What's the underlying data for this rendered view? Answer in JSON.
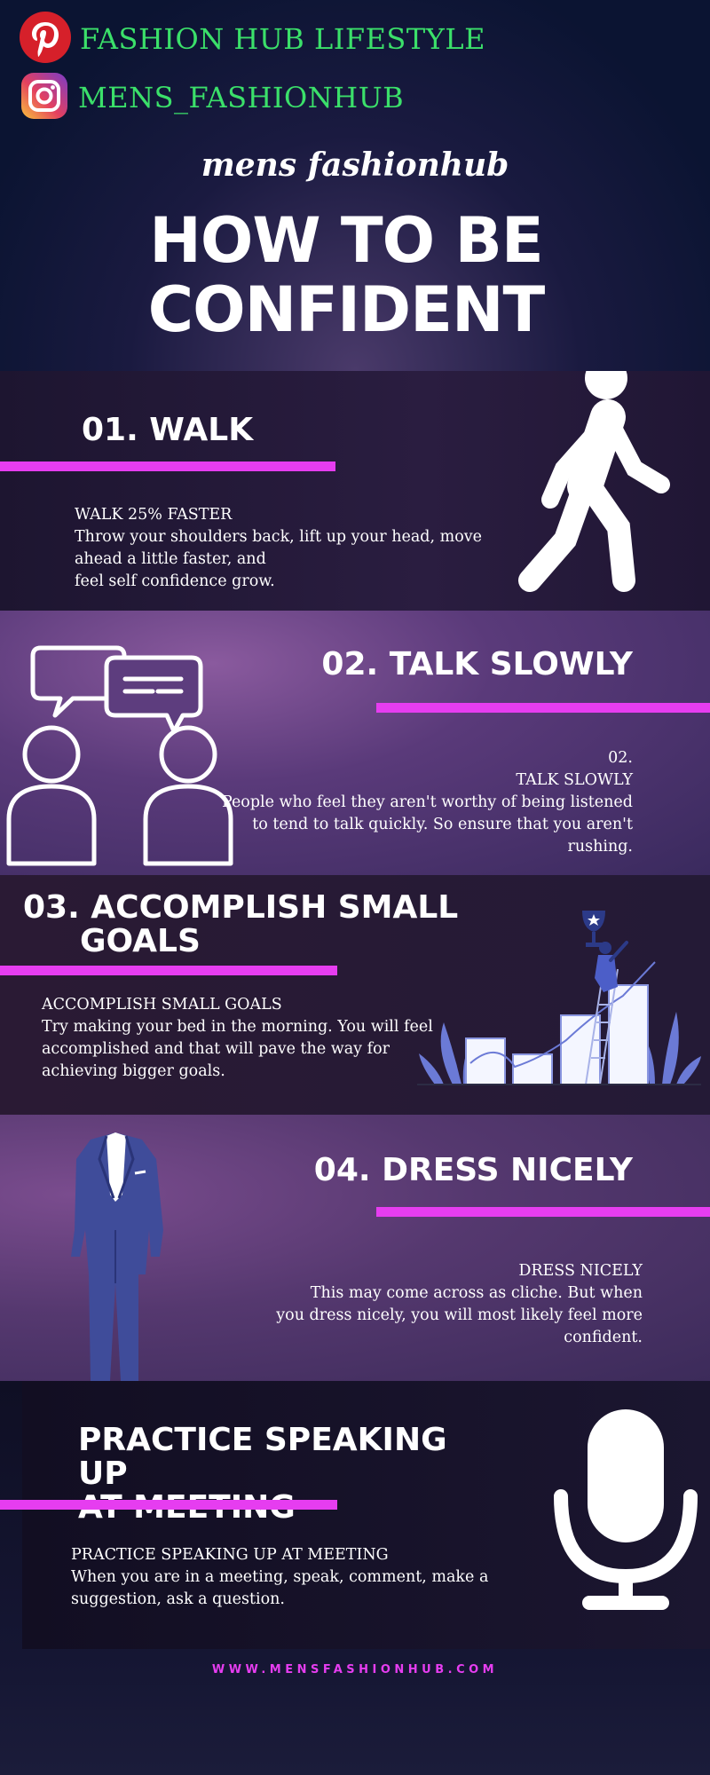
{
  "social": {
    "pinterest_label": "FASHION HUB LIFESTYLE",
    "instagram_label": "MENS_FASHIONHUB"
  },
  "brand": "mens fashionhub",
  "title": {
    "line1": "HOW TO BE",
    "line2": "CONFIDENT"
  },
  "sections": [
    {
      "heading": "01.  WALK",
      "subheading": "WALK 25% FASTER",
      "body": [
        "Throw your shoulders back, lift up your head, move",
        "ahead a little faster, and",
        "feel self confidence grow."
      ]
    },
    {
      "heading": "02. TALK SLOWLY",
      "label": "02.",
      "subheading": "TALK SLOWLY",
      "body": [
        "People who feel they aren't worthy of being listened",
        "to tend to talk quickly. So ensure that you aren't",
        "rushing."
      ]
    },
    {
      "heading_line1": "03. ACCOMPLISH SMALL",
      "heading_line2": "GOALS",
      "subheading": "ACCOMPLISH SMALL GOALS",
      "body": [
        "Try making your bed in the morning. You will feel",
        "accomplished and that will pave the way for",
        "achieving bigger goals."
      ]
    },
    {
      "heading": "04. DRESS NICELY",
      "subheading": "DRESS NICELY",
      "body": [
        "This may come across as cliche. But when",
        "you dress nicely, you will most likely feel more",
        "confident."
      ]
    },
    {
      "heading_line1": "PRACTICE SPEAKING UP",
      "heading_line2": "AT MEETING",
      "subheading": "PRACTICE SPEAKING UP AT MEETING",
      "body": [
        "When you are in a meeting, speak, comment, make a",
        "suggestion, ask a question."
      ]
    }
  ],
  "footer": {
    "url": "WWW.MENSFASHIONHUB.COM"
  },
  "colors": {
    "accent_bar": "#e63df0",
    "social_text": "#3be06a",
    "pinterest": "#d6202a"
  },
  "icons": [
    "pinterest-icon",
    "instagram-icon",
    "walking-man-icon",
    "chat-people-icon",
    "trophy-chart-icon",
    "suit-icon",
    "microphone-icon"
  ]
}
